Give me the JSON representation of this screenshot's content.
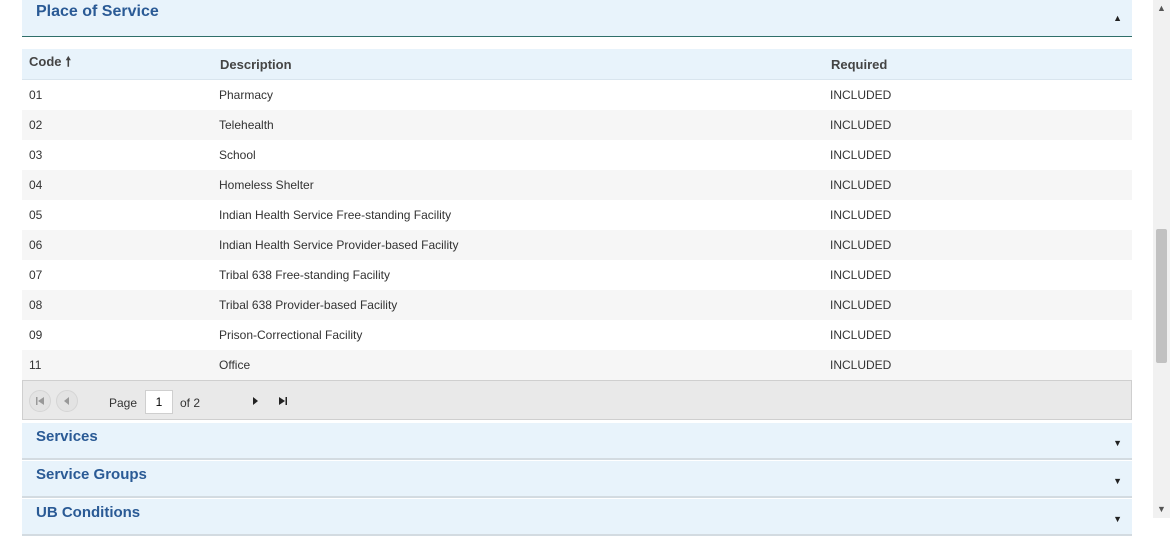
{
  "place_of_service": {
    "title": "Place of Service",
    "columns": {
      "code": "Code",
      "description": "Description",
      "required": "Required"
    },
    "sort_indicator": "🠕",
    "rows": [
      {
        "code": "01",
        "description": "Pharmacy",
        "required": "INCLUDED"
      },
      {
        "code": "02",
        "description": "Telehealth",
        "required": "INCLUDED"
      },
      {
        "code": "03",
        "description": "School",
        "required": "INCLUDED"
      },
      {
        "code": "04",
        "description": "Homeless Shelter",
        "required": "INCLUDED"
      },
      {
        "code": "05",
        "description": "Indian Health Service Free-standing Facility",
        "required": "INCLUDED"
      },
      {
        "code": "06",
        "description": "Indian Health Service Provider-based Facility",
        "required": "INCLUDED"
      },
      {
        "code": "07",
        "description": "Tribal 638 Free-standing Facility",
        "required": "INCLUDED"
      },
      {
        "code": "08",
        "description": "Tribal 638 Provider-based Facility",
        "required": "INCLUDED"
      },
      {
        "code": "09",
        "description": "Prison-Correctional Facility",
        "required": "INCLUDED"
      },
      {
        "code": "11",
        "description": "Office",
        "required": "INCLUDED"
      }
    ],
    "pager": {
      "page_label": "Page",
      "current_page": "1",
      "of_label": "of 2"
    }
  },
  "collapsed_sections": [
    {
      "title": "Services"
    },
    {
      "title": "Service Groups"
    },
    {
      "title": "UB Conditions"
    }
  ],
  "icons": {
    "collapse": "▲",
    "expand": "▼",
    "first_page": "first-page-icon",
    "prev_page": "prev-page-icon",
    "next_page": "next-page-icon",
    "last_page": "last-page-icon"
  },
  "colors": {
    "section_header_bg": "#e8f3fb",
    "section_title": "#2a5a95",
    "alt_row_bg": "#f6f6f6"
  }
}
